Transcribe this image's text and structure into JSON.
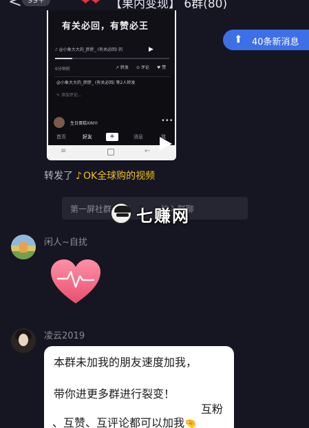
{
  "header": {
    "back_glyph": "<",
    "unread_badge": "99+",
    "title_hearts": "❤❤",
    "group_title": "【果内变现】 6群(80)",
    "more_glyph": "•••"
  },
  "video_card": {
    "overlay_text": "有关必回，有赞必王",
    "music_line": "♪ @小象大大的_胖胖_ (有关必回) 的",
    "play_glyph": "▶",
    "progress": 0.15,
    "time": "6分钟前",
    "repost_label": "↗ 转发",
    "comment_label": "⊙ 评论",
    "like_label": "♥ 赞",
    "comment_line": "@小象大大的_胖胖_ (有关必回) 等2人转发",
    "comment_placeholder": "✎ 添加评论...",
    "author_name": "生日蛋糕XINYI",
    "author_more": "•••",
    "nav": {
      "home": "首页",
      "friends": "好友",
      "plus": "+",
      "messages": "消息",
      "me": "我"
    },
    "sys_bar": {
      "menu_glyph": "≡",
      "back_glyph": "←"
    }
  },
  "forward": {
    "prefix": "转发了",
    "tiktok_icon": "♪",
    "source": "OK全球购的视频"
  },
  "new_messages": {
    "arrow_glyph": "⬆",
    "label": "40条新消息"
  },
  "system_notice": {
    "text": "第一屏社群  人将  　　　 拉入群聊"
  },
  "watermark": {
    "text": "七赚网"
  },
  "messages": [
    {
      "sender": "闲人~自扰",
      "sticker": "heart-sticker"
    },
    {
      "sender": "凌云2019",
      "lines": [
        "本群未加我的朋友速度加我，",
        "带你进更多群进行裂变！",
        "互粉",
        "、互赞、互评论都可以加我"
      ],
      "hand_icon": "🤏"
    }
  ],
  "colors": {
    "background": "#161622",
    "accent_blue": "#3d6fe6",
    "tiktok_yellow": "#f3c21a",
    "heart_pink": "#f06b86"
  }
}
